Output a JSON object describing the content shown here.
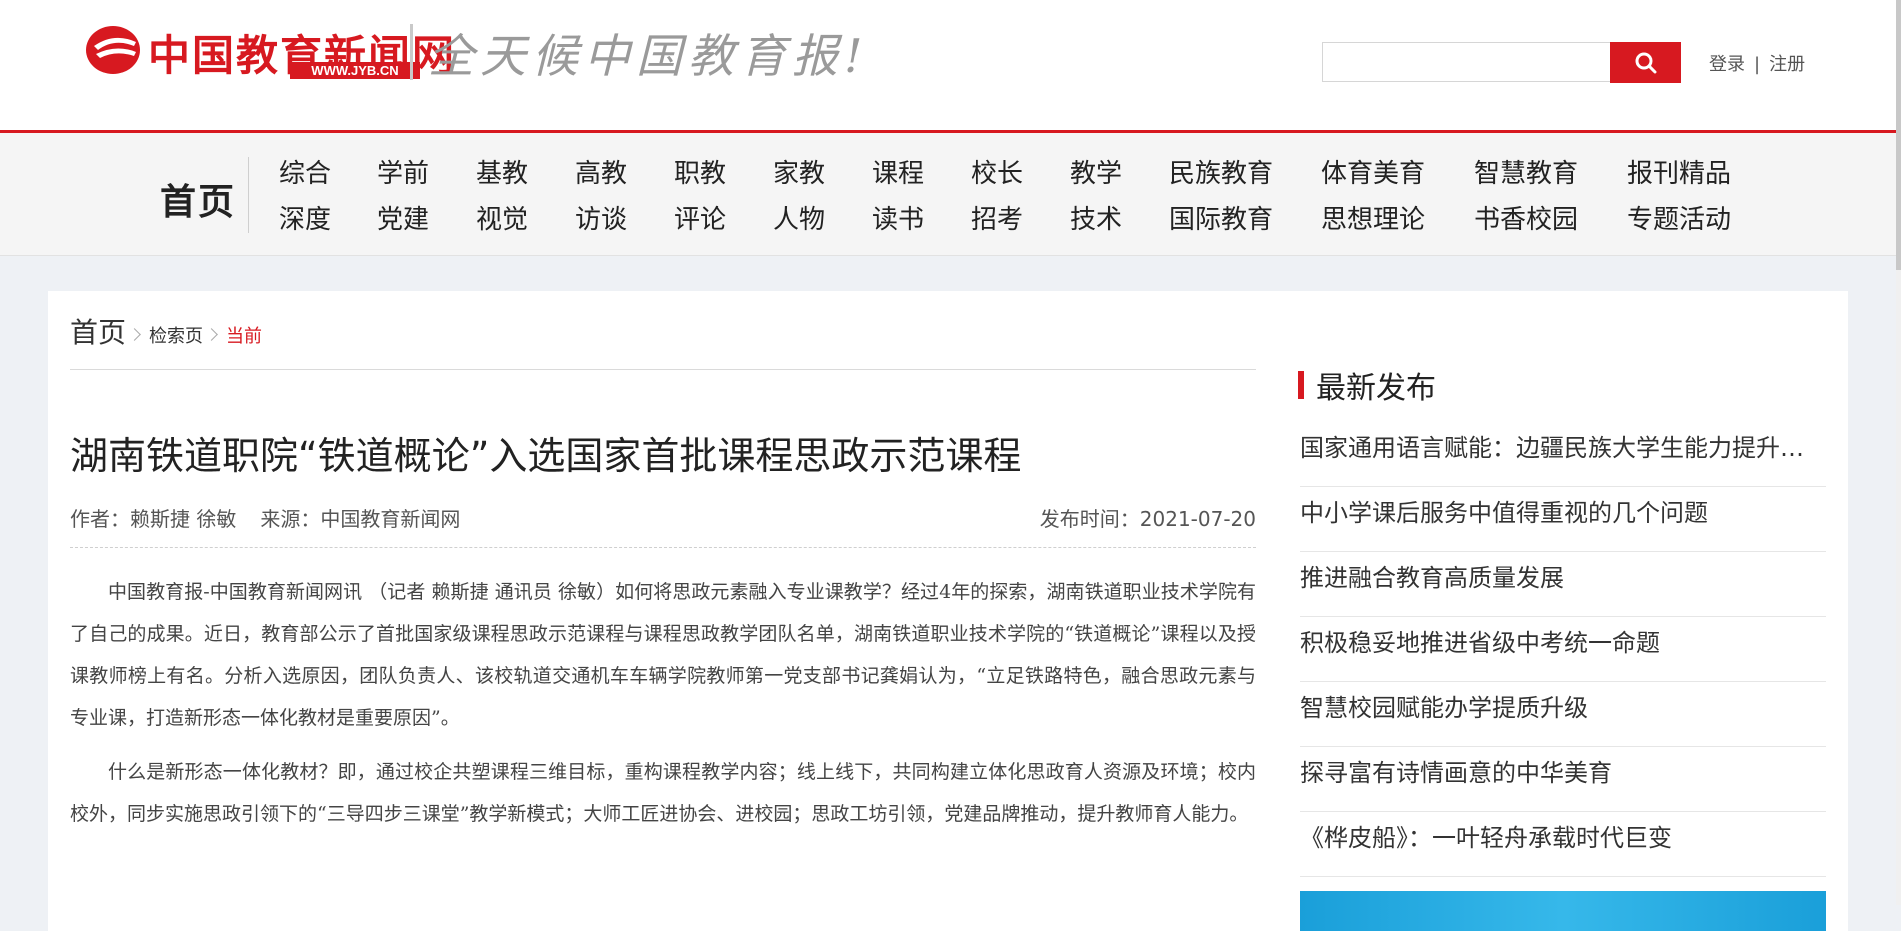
{
  "header": {
    "logo_text": "中国教育新闻网",
    "logo_url": "WWW.JYB.CN",
    "slogan": "全天候中国教育报!",
    "search_placeholder": "",
    "login": "登录",
    "separator": "|",
    "register": "注册",
    "accent_color": "#d71920"
  },
  "nav": {
    "home": "首页",
    "columns": [
      [
        "综合",
        "深度"
      ],
      [
        "学前",
        "党建"
      ],
      [
        "基教",
        "视觉"
      ],
      [
        "高教",
        "访谈"
      ],
      [
        "职教",
        "评论"
      ],
      [
        "家教",
        "人物"
      ],
      [
        "课程",
        "读书"
      ],
      [
        "校长",
        "招考"
      ],
      [
        "教学",
        "技术"
      ],
      [
        "民族教育",
        "国际教育"
      ],
      [
        "体育美育",
        "思想理论"
      ],
      [
        "智慧教育",
        "书香校园"
      ],
      [
        "报刊精品",
        "专题活动"
      ]
    ]
  },
  "breadcrumb": {
    "home": "首页",
    "search": "检索页",
    "current": "当前"
  },
  "article": {
    "title": "湖南铁道职院“铁道概论”入选国家首批课程思政示范课程",
    "author": "作者：赖斯捷 徐敏",
    "source": "来源：中国教育新闻网",
    "publish_time": "发布时间：2021-07-20",
    "paragraphs": [
      "中国教育报-中国教育新闻网讯 （记者 赖斯捷 通讯员 徐敏）如何将思政元素融入专业课教学？经过4年的探索，湖南铁道职业技术学院有了自己的成果。近日，教育部公示了首批国家级课程思政示范课程与课程思政教学团队名单，湖南铁道职业技术学院的“铁道概论”课程以及授课教师榜上有名。分析入选原因，团队负责人、该校轨道交通机车车辆学院教师第一党支部书记龚娟认为，“立足铁路特色，融合思政元素与专业课，打造新形态一体化教材是重要原因”。",
      "什么是新形态一体化教材？即，通过校企共塑课程三维目标，重构课程教学内容；线上线下，共同构建立体化思政育人资源及环境；校内校外，同步实施思政引领下的“三导四步三课堂”教学新模式；大师工匠进协会、进校园；思政工坊引领，党建品牌推动，提升教师育人能力。"
    ]
  },
  "sidebar": {
    "title": "最新发布",
    "items": [
      "国家通用语言赋能：边疆民族大学生能力提升的路径与思考",
      "中小学课后服务中值得重视的几个问题",
      "推进融合教育高质量发展",
      "积极稳妥地推进省级中考统一命题",
      "智慧校园赋能办学提质升级",
      "探寻富有诗情画意的中华美育",
      "《桦皮船》：一叶轻舟承载时代巨变"
    ]
  }
}
